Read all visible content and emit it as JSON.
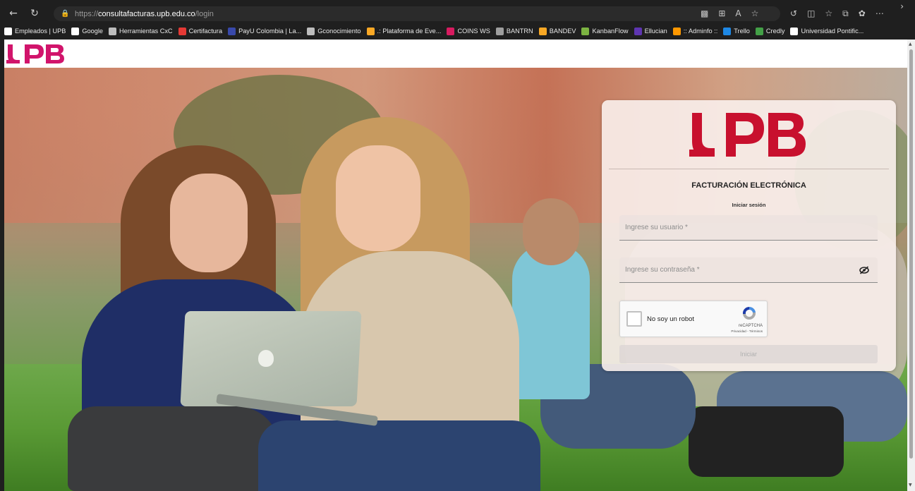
{
  "browser": {
    "url": {
      "protocol": "https://",
      "host": "consultafacturas.upb.edu.co",
      "path": "/login"
    },
    "bookmarks": [
      {
        "label": "Empleados | UPB",
        "color": "#ffffff"
      },
      {
        "label": "Google",
        "color": "#ffffff"
      },
      {
        "label": "Herramientas CxC",
        "color": "#bdbdbd"
      },
      {
        "label": "Certifactura",
        "color": "#e53935"
      },
      {
        "label": "PayU Colombia | La...",
        "color": "#3949ab"
      },
      {
        "label": "Gconocimiento",
        "color": "#bdbdbd"
      },
      {
        "label": ".: Plataforma de Eve...",
        "color": "#f9a825"
      },
      {
        "label": "COINS WS",
        "color": "#d81b60"
      },
      {
        "label": "BANTRN",
        "color": "#9e9e9e"
      },
      {
        "label": "BANDEV",
        "color": "#f9a825"
      },
      {
        "label": "KanbanFlow",
        "color": "#7cb342"
      },
      {
        "label": "Ellucian",
        "color": "#5e35b1"
      },
      {
        "label": ":: Adminfo ::",
        "color": "#ff9800"
      },
      {
        "label": "Trello",
        "color": "#1e88e5"
      },
      {
        "label": "Credly",
        "color": "#43a047"
      },
      {
        "label": "Universidad Pontific...",
        "color": "#ffffff"
      }
    ]
  },
  "header": {
    "logo_text": "UPB"
  },
  "login": {
    "logo_text": "UPB",
    "title": "FACTURACIÓN ELECTRÓNICA",
    "subtitle": "Iniciar sesión",
    "username_placeholder": "Ingrese su usuario *",
    "password_placeholder": "Ingrese su contraseña *",
    "captcha_label": "No soy un robot",
    "captcha_brand": "reCAPTCHA",
    "captcha_terms": "Privacidad - Términos",
    "submit_label": "Iniciar"
  },
  "colors": {
    "brand": "#d1146b",
    "brand_red": "#c8102e"
  }
}
